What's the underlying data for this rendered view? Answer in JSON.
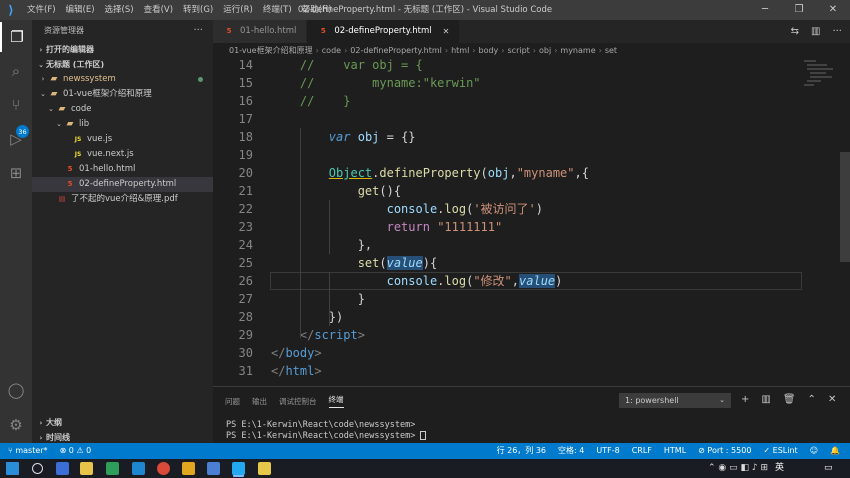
{
  "window": {
    "title": "02-defineProperty.html - 无标题 (工作区) - Visual Studio Code",
    "menu": [
      "文件(F)",
      "编辑(E)",
      "选择(S)",
      "查看(V)",
      "转到(G)",
      "运行(R)",
      "终端(T)",
      "帮助(H)"
    ]
  },
  "activity": {
    "scm_badge": "36"
  },
  "sidebar": {
    "title": "资源管理器",
    "open_editors": "打开的编辑器",
    "workspace": "无标题 (工作区)",
    "tree": [
      {
        "label": "newssystem",
        "type": "folder",
        "depth": 0,
        "twisty": "›",
        "color": "#e2c08d"
      },
      {
        "label": "01-vue框架介绍和原理",
        "type": "folder",
        "depth": 0,
        "twisty": "⌄"
      },
      {
        "label": "code",
        "type": "folder",
        "depth": 1,
        "twisty": "⌄"
      },
      {
        "label": "lib",
        "type": "folder",
        "depth": 2,
        "twisty": "⌄"
      },
      {
        "label": "vue.js",
        "type": "js",
        "depth": 3,
        "twisty": ""
      },
      {
        "label": "vue.next.js",
        "type": "js",
        "depth": 3,
        "twisty": ""
      },
      {
        "label": "01-hello.html",
        "type": "html",
        "depth": 2,
        "twisty": ""
      },
      {
        "label": "02-defineProperty.html",
        "type": "html",
        "depth": 2,
        "twisty": "",
        "selected": true
      },
      {
        "label": "了不起的vue介绍&原理.pdf",
        "type": "pdf",
        "depth": 1,
        "twisty": ""
      }
    ],
    "outline": "大纲",
    "timeline": "时间线"
  },
  "tabs": [
    {
      "label": "01-hello.html",
      "active": false
    },
    {
      "label": "02-defineProperty.html",
      "active": true
    }
  ],
  "breadcrumb": [
    "01-vue框架介绍和原理",
    "code",
    "02-defineProperty.html",
    "html",
    "body",
    "script",
    "obj",
    "myname",
    "set"
  ],
  "editor": {
    "lines": [
      {
        "n": "14",
        "html": "<span class='cm'>    //    var obj = {</span>"
      },
      {
        "n": "15",
        "html": "<span class='cm'>    //        myname:\"kerwin\"</span>"
      },
      {
        "n": "16",
        "html": "<span class='cm'>    //    }</span>"
      },
      {
        "n": "17",
        "html": ""
      },
      {
        "n": "18",
        "html": "        <span class='kw'>var</span> <span class='var'>obj</span> = {}"
      },
      {
        "n": "19",
        "html": ""
      },
      {
        "n": "20",
        "html": "        <span class='obj'>Object</span>.<span class='fn'>defineProperty</span>(<span class='var'>obj</span>,<span class='str'>\"myname\"</span>,{"
      },
      {
        "n": "21",
        "html": "            <span class='fn'>get</span>(){"
      },
      {
        "n": "22",
        "html": "                <span class='var'>console</span>.<span class='fn'>log</span>(<span class='str'>'被访问了'</span>)"
      },
      {
        "n": "23",
        "html": "                <span class='kw2'>return</span> <span class='str'>\"1111111\"</span>"
      },
      {
        "n": "24",
        "html": "            },"
      },
      {
        "n": "25",
        "html": "            <span class='fn'>set</span>(<span class='param'>value</span>){"
      },
      {
        "n": "26",
        "html": "                <span class='var'>console</span>.<span class='fn'>log</span>(<span class='str'>\"修改\"</span>,<span class='param'>value</span>)"
      },
      {
        "n": "27",
        "html": "            }"
      },
      {
        "n": "28",
        "html": "        })"
      },
      {
        "n": "29",
        "html": "    <span class='tagb'>&lt;/</span><span class='tag'>script</span><span class='tagb'>&gt;</span>"
      },
      {
        "n": "30",
        "html": "<span class='tagb'>&lt;/</span><span class='tag'>body</span><span class='tagb'>&gt;</span>"
      },
      {
        "n": "31",
        "html": "<span class='tagb'>&lt;/</span><span class='tag'>html</span><span class='tagb'>&gt;</span>"
      }
    ],
    "current_line": "26"
  },
  "panel": {
    "tabs": [
      "问题",
      "输出",
      "调试控制台",
      "终端"
    ],
    "active_tab": "终端",
    "terminal_select": "1: powershell",
    "terminal_lines": [
      "PS E:\\1-Kerwin\\React\\code\\newssystem>",
      "PS E:\\1-Kerwin\\React\\code\\newssystem> "
    ]
  },
  "status": {
    "branch": "master*",
    "problems": "⊗ 0 ⚠ 0",
    "position": "行 26，列 36",
    "spaces": "空格: 4",
    "encoding": "UTF-8",
    "eol": "CRLF",
    "language": "HTML",
    "port": "Port : 5500",
    "eslint": "ESLint"
  },
  "taskbar": {
    "ime": "英"
  }
}
